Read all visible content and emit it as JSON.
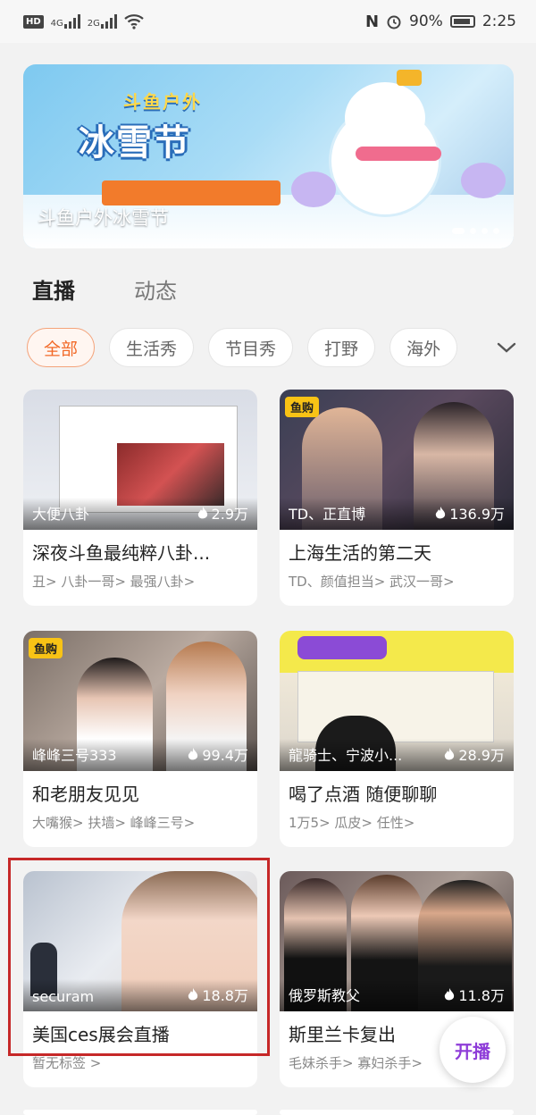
{
  "status_bar": {
    "hd": "HD",
    "net1": "4G",
    "net2": "2G",
    "battery_pct": "90%",
    "time": "2:25"
  },
  "banner": {
    "brand_small": "斗鱼户外",
    "brand": "冰雪节",
    "title": "斗鱼户外冰雪节"
  },
  "tabs": [
    {
      "label": "直播",
      "active": true
    },
    {
      "label": "动态",
      "active": false
    }
  ],
  "chips": [
    "全部",
    "生活秀",
    "节目秀",
    "打野",
    "海外"
  ],
  "cards": [
    {
      "anchor": "大便八卦",
      "heat": "2.9万",
      "title": "深夜斗鱼最纯粹八卦...",
      "tags": "丑> 八卦一哥> 最强八卦>"
    },
    {
      "anchor": "TD、正直博",
      "heat": "136.9万",
      "title": "上海生活的第二天",
      "tags": "TD、颜值担当> 武汉一哥>",
      "badge": "鱼购"
    },
    {
      "anchor": "峰峰三号333",
      "heat": "99.4万",
      "title": "和老朋友见见",
      "tags": "大嘴猴> 扶墙> 峰峰三号>",
      "badge": "鱼购"
    },
    {
      "anchor": "龍骑士、宁波小...",
      "heat": "28.9万",
      "title": "喝了点酒 随便聊聊",
      "tags": "1万5> 瓜皮> 任性>"
    },
    {
      "anchor": "securam",
      "heat": "18.8万",
      "title": "美国ces展会直播",
      "tags": "暂无标签 >"
    },
    {
      "anchor": "俄罗斯教父",
      "heat": "11.8万",
      "title": "斯里兰卡复出",
      "tags": "毛妹杀手> 寡妇杀手>"
    }
  ],
  "fab_label": "开播"
}
